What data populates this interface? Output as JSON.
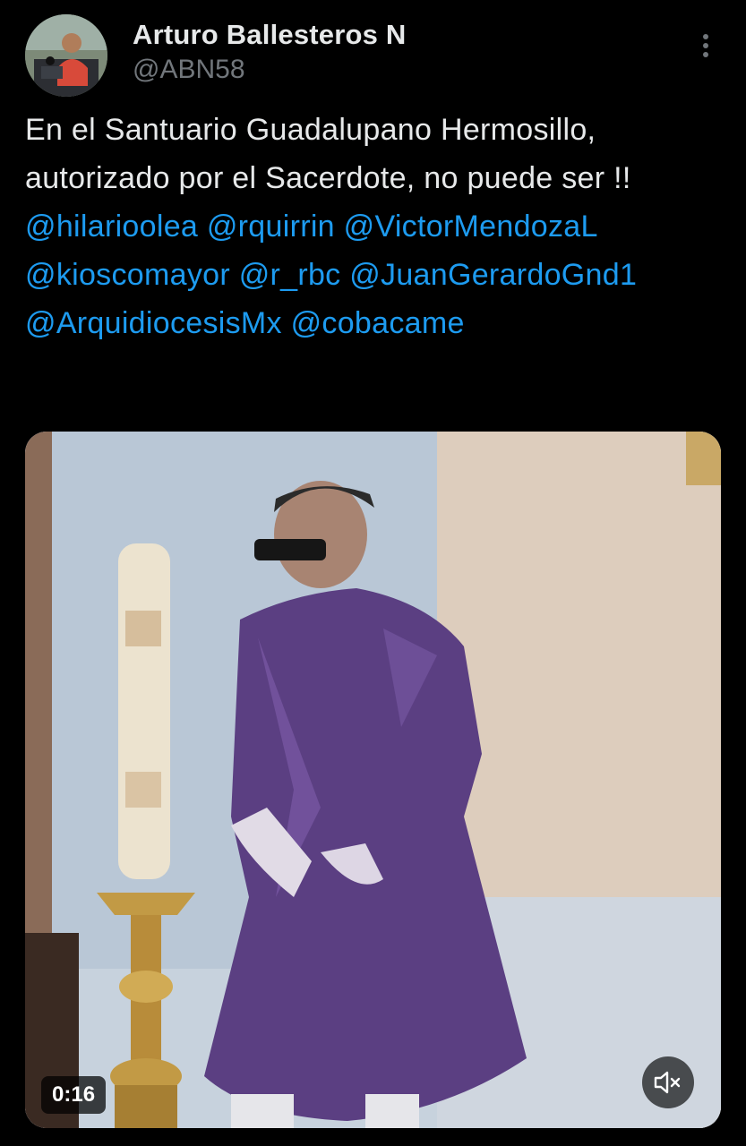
{
  "author": {
    "display_name": "Arturo Ballesteros N",
    "handle": "@ABN58",
    "avatar_icon": "profile-photo"
  },
  "tweet": {
    "text_plain": "En el Santuario Guadalupano Hermosillo, autorizado por el Sacerdote, no puede ser !!",
    "mentions": [
      "@hilarioolea",
      "@rquirrin",
      "@VictorMendozaL",
      "@kioscomayor",
      "@r_rbc",
      "@JuanGerardoGnd1",
      "@ArquidiocesisMx",
      "@cobacame"
    ]
  },
  "media": {
    "type": "video",
    "duration": "0:16",
    "mute_icon": "speaker-muted-icon"
  },
  "colors": {
    "background": "#000000",
    "text": "#e7e9ea",
    "secondary_text": "#71767b",
    "link": "#1d9bf0"
  },
  "icons": {
    "more": "more-vertical-icon"
  }
}
